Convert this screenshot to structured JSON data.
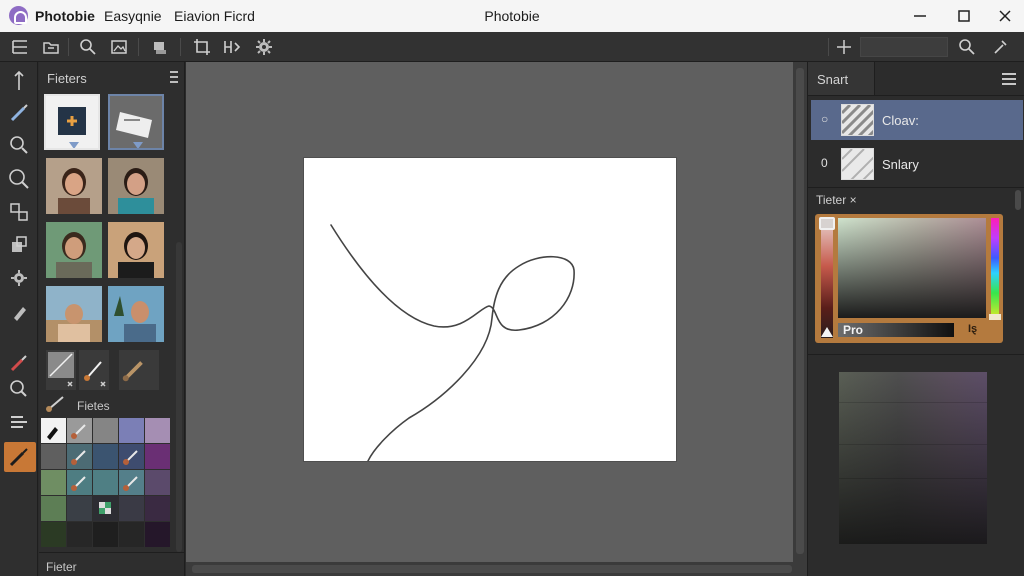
{
  "titlebar": {
    "app_name": "Photobie",
    "menu": [
      "Easyqnie",
      "Eiavion Ficrd"
    ],
    "window_title": "Photobie"
  },
  "filters_panel": {
    "title": "Fieters",
    "sub_label": "Fietes",
    "bottom_label": "Fieter"
  },
  "layers_panel": {
    "tab": "Snart",
    "layers": [
      {
        "visibility": "○",
        "name": "Cloav:"
      },
      {
        "visibility": "0",
        "name": "Snlary"
      }
    ]
  },
  "color_section": {
    "header": "Tieter ×",
    "pro_label": "Pro",
    "pro_value": "Iȿ"
  },
  "swatches": [
    "#f2f2f2",
    "#9a9a9a",
    "#858585",
    "#7b7fb6",
    "#a58eb3",
    "#5f5f5f",
    "#4c6b74",
    "#3b5470",
    "#3e4c6f",
    "#6a2f74",
    "#6f8e63",
    "#4e7d82",
    "#4f7f84",
    "#547f8a",
    "#5b4a6b",
    "#5d7e55",
    "#3a3f46",
    "#2d2d33",
    "#3a3a45",
    "#3a2a42",
    "#2b3a24",
    "#272727",
    "#1f1f1f",
    "#262626",
    "#25172a"
  ]
}
